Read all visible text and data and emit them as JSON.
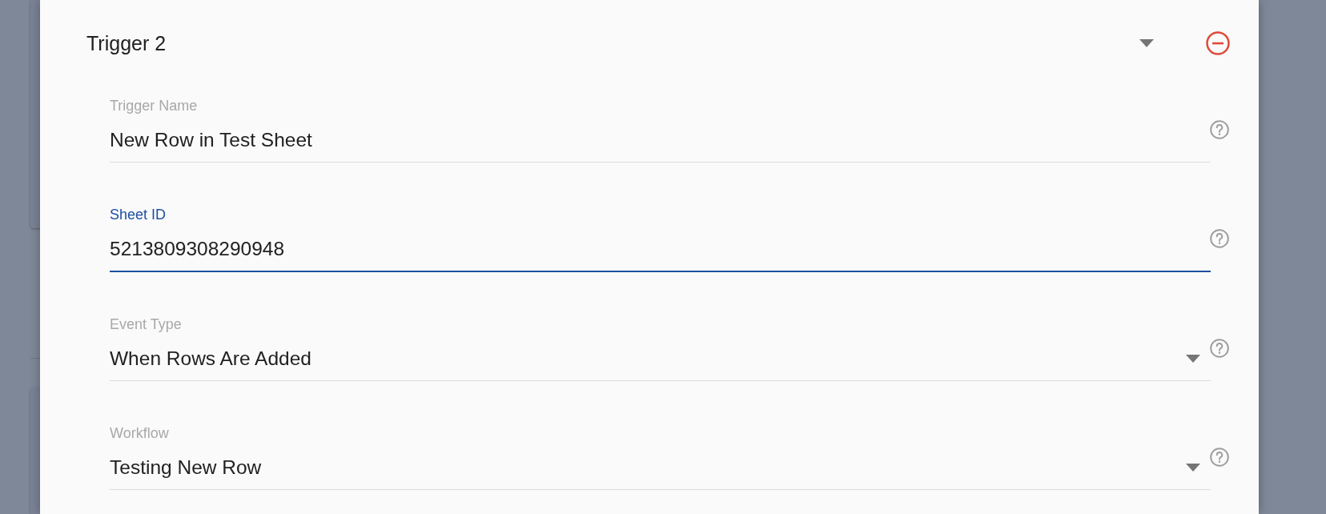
{
  "trigger": {
    "title": "Trigger 2",
    "expanded": true,
    "fields": [
      {
        "kind": "text",
        "label": "Trigger Name",
        "value": "New Row in Test Sheet",
        "focused": false
      },
      {
        "kind": "text",
        "label": "Sheet ID",
        "value": "5213809308290948",
        "focused": true
      },
      {
        "kind": "select",
        "label": "Event Type",
        "value": "When Rows Are Added",
        "focused": false
      },
      {
        "kind": "select",
        "label": "Workflow",
        "value": "Testing New Row",
        "focused": false
      }
    ]
  }
}
